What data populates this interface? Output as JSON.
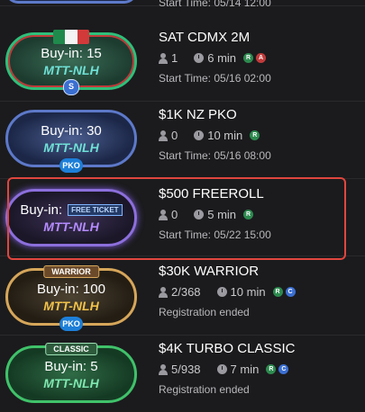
{
  "top_partial": {
    "start_time": "Start Time: 05/14 12:00"
  },
  "tournaments": [
    {
      "title": "SAT CDMX 2M",
      "buyin": "Buy-in: 15",
      "game": "MTT-NLH",
      "players": "1",
      "duration": "6 min",
      "status_badges": [
        "R",
        "A"
      ],
      "subline": "Start Time: 05/16 02:00",
      "flag": "mexico",
      "bottom_badge": "S"
    },
    {
      "title": "$1K NZ PKO",
      "buyin": "Buy-in: 30",
      "game": "MTT-NLH",
      "players": "0",
      "duration": "10 min",
      "status_badges": [
        "R"
      ],
      "subline": "Start Time: 05/16 08:00",
      "bottom_badge": "PKO"
    },
    {
      "title": "$500 FREEROLL",
      "buyin": "Buy-in:",
      "free_ticket": "FREE TICKET",
      "game": "MTT-NLH",
      "players": "0",
      "duration": "5 min",
      "status_badges": [
        "R"
      ],
      "subline": "Start Time: 05/22 15:00",
      "highlighted": true
    },
    {
      "title": "$30K WARRIOR",
      "buyin": "Buy-in: 100",
      "game": "MTT-NLH",
      "top_tag": "WARRIOR",
      "players": "2/368",
      "duration": "10 min",
      "status_badges": [
        "R",
        "C"
      ],
      "subline": "Registration ended",
      "bottom_badge": "PKO"
    },
    {
      "title": "$4K TURBO CLASSIC",
      "buyin": "Buy-in: 5",
      "game": "MTT-NLH",
      "top_tag": "CLASSIC",
      "players": "5/938",
      "duration": "7 min",
      "status_badges": [
        "R",
        "C"
      ],
      "subline": "Registration ended"
    }
  ],
  "colors": {
    "background": "#1b1b1d",
    "highlight_border": "#e0463e",
    "registering_badge": "#2d8a4f",
    "late_badge": "#c23b3b",
    "pko_badge": "#1d7fd8"
  },
  "icons": {
    "players": "person-icon",
    "duration": "clock-icon"
  }
}
